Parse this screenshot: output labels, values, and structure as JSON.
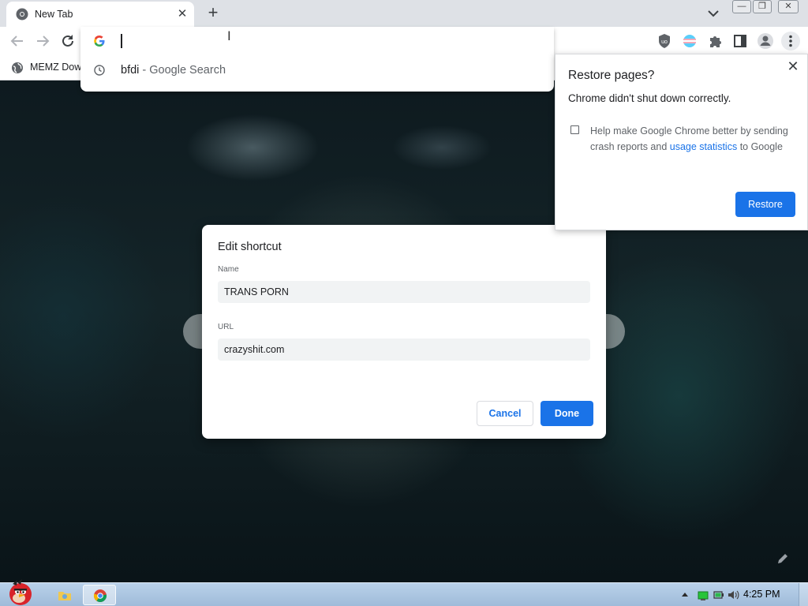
{
  "browser": {
    "tab": {
      "title": "New Tab",
      "close_symbol": "✕"
    },
    "new_tab_symbol": "+",
    "window_controls": {
      "minimize": "—",
      "maximize": "❐",
      "close": "✕"
    },
    "omnibox": {
      "value": "",
      "suggestion": {
        "query": "bfdi",
        "description": " - Google Search"
      }
    },
    "bookmarks": [
      {
        "label": "MEMZ Dow",
        "icon": "globe-icon"
      }
    ],
    "extensions": [
      "ublock-icon",
      "trans-flag-icon",
      "puzzle-icon",
      "side-panel-icon",
      "profile-icon",
      "menu-icon"
    ]
  },
  "restore_popup": {
    "title": "Restore pages?",
    "message": "Chrome didn't shut down correctly.",
    "help_text_prefix": "Help make Google Chrome better by sending crash reports and ",
    "help_link": "usage statistics",
    "help_text_suffix": " to Google",
    "checkbox_checked": false,
    "restore_button": "Restore",
    "close_symbol": "✕"
  },
  "edit_shortcut": {
    "title": "Edit shortcut",
    "name_label": "Name",
    "name_value": "TRANS PORN",
    "url_label": "URL",
    "url_value": "crazyshit.com",
    "cancel_label": "Cancel",
    "done_label": "Done"
  },
  "taskbar": {
    "clock": "4:25 PM",
    "apps": [
      "angry-bird-start-icon",
      "explorer-folder-icon",
      "chrome-icon"
    ],
    "tray": [
      "show-hidden-icons-arrow",
      "network-icon",
      "battery-icon",
      "volume-icon"
    ]
  },
  "colors": {
    "accent": "#1a73e8",
    "tabstrip": "#dee1e6",
    "taskbar": "#b9d1ea"
  }
}
